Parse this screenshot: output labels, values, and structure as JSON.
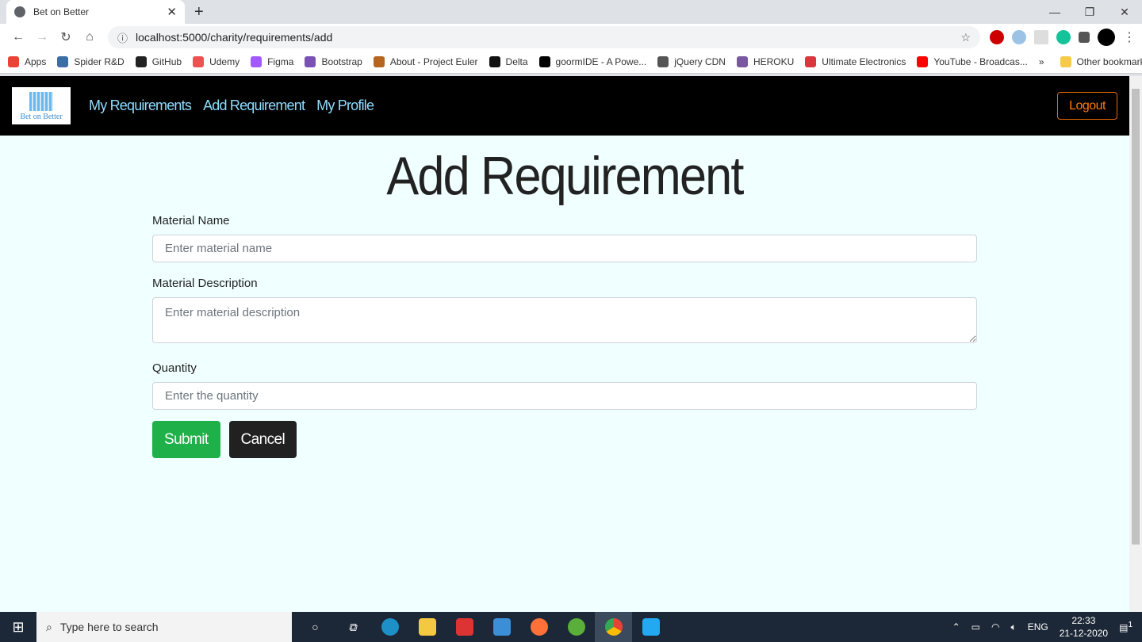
{
  "browser": {
    "tab_title": "Bet on Better",
    "url": "localhost:5000/charity/requirements/add",
    "bookmarks": [
      {
        "label": "Apps",
        "color": "#ea4335"
      },
      {
        "label": "Spider R&D",
        "color": "#3b6ea5"
      },
      {
        "label": "GitHub",
        "color": "#222222"
      },
      {
        "label": "Udemy",
        "color": "#ec5252"
      },
      {
        "label": "Figma",
        "color": "#a259ff"
      },
      {
        "label": "Bootstrap",
        "color": "#7952b3"
      },
      {
        "label": "About - Project Euler",
        "color": "#b5651d"
      },
      {
        "label": "Delta",
        "color": "#111111"
      },
      {
        "label": "goormIDE - A Powe...",
        "color": "#000000"
      },
      {
        "label": "jQuery CDN",
        "color": "#555555"
      },
      {
        "label": "HEROKU",
        "color": "#79589f"
      },
      {
        "label": "Ultimate Electronics",
        "color": "#d9363e"
      },
      {
        "label": "YouTube - Broadcas...",
        "color": "#ff0000"
      }
    ],
    "more": "»",
    "other_bookmarks": "Other bookmarks"
  },
  "navbar": {
    "logo_text": "Bet on Better",
    "links": [
      "My Requirements",
      "Add Requirement",
      "My Profile"
    ],
    "logout": "Logout"
  },
  "page": {
    "title": "Add Requirement",
    "fields": [
      {
        "label": "Material Name",
        "placeholder": "Enter material name"
      },
      {
        "label": "Material Description",
        "placeholder": "Enter material description"
      },
      {
        "label": "Quantity",
        "placeholder": "Enter the quantity"
      }
    ],
    "submit": "Submit",
    "cancel": "Cancel"
  },
  "taskbar": {
    "search_placeholder": "Type here to search",
    "lang": "ENG",
    "time": "22:33",
    "date": "21-12-2020",
    "notifications": "1"
  },
  "colors": {
    "accent_link": "#8fdcff",
    "logout": "#ff7b00",
    "submit": "#1fb04a",
    "background": "#f0ffff"
  }
}
